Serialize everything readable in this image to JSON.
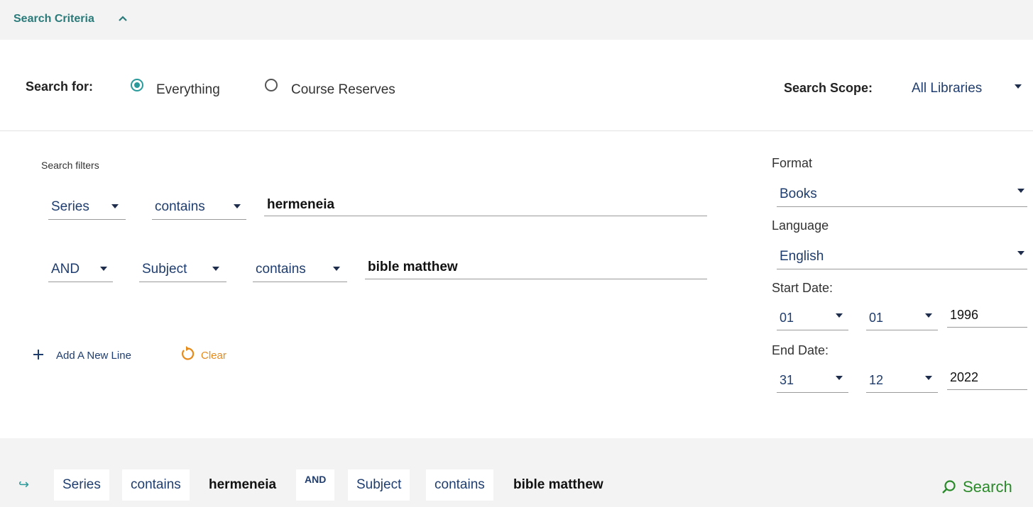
{
  "header": {
    "title": "Search Criteria"
  },
  "search_for": {
    "label": "Search for:",
    "options": [
      {
        "label": "Everything",
        "selected": true
      },
      {
        "label": "Course Reserves",
        "selected": false
      }
    ]
  },
  "scope": {
    "label": "Search Scope:",
    "value": "All Libraries"
  },
  "filters": {
    "title": "Search filters",
    "row1": {
      "field": "Series",
      "operator": "contains",
      "value": "hermeneia"
    },
    "row2": {
      "boolean": "AND",
      "field": "Subject",
      "operator": "contains",
      "value": "bible matthew"
    },
    "add_line": "Add A New Line",
    "clear": "Clear"
  },
  "side": {
    "format_label": "Format",
    "format_value": "Books",
    "language_label": "Language",
    "language_value": "English",
    "start_label": "Start Date:",
    "start_day": "01",
    "start_month": "01",
    "start_year": "1996",
    "end_label": "End Date:",
    "end_day": "31",
    "end_month": "12",
    "end_year": "2022"
  },
  "summary": {
    "arrow": "↪",
    "chips": [
      "Series",
      "contains",
      "hermeneia",
      "AND",
      "Subject",
      "contains",
      "bible matthew"
    ],
    "search_label": "Search"
  },
  "colors": {
    "teal": "#2a9a9a",
    "navy": "#1f3d6e",
    "orange": "#e68a1a",
    "green": "#2a8a2a"
  }
}
